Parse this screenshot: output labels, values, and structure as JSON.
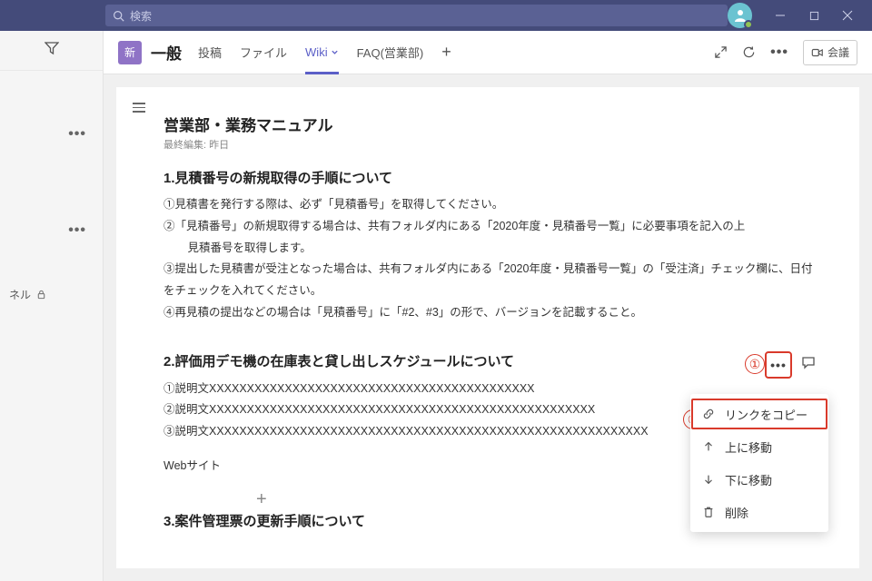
{
  "search": {
    "placeholder": "検索"
  },
  "window": {
    "avatar_initial": ""
  },
  "sidebar": {
    "channel_partial": "ネル",
    "locked": true
  },
  "channel": {
    "team_badge": "新",
    "name": "一般",
    "tabs": [
      {
        "label": "投稿",
        "active": false
      },
      {
        "label": "ファイル",
        "active": false
      },
      {
        "label": "Wiki",
        "active": true,
        "dropdown": true
      },
      {
        "label": "FAQ(営業部)",
        "active": false
      }
    ],
    "meet_label": "会議"
  },
  "doc": {
    "title": "営業部・業務マニュアル",
    "meta": "最終編集: 昨日",
    "sections": [
      {
        "title": "1.見積番号の新規取得の手順について",
        "lines": [
          "①見積書を発行する際は、必ず「見積番号」を取得してください。",
          "②「見積番号」の新規取得する場合は、共有フォルダ内にある「2020年度・見積番号一覧」に必要事項を記入の上",
          "　見積番号を取得します。",
          "③提出した見積書が受注となった場合は、共有フォルダ内にある「2020年度・見積番号一覧」の「受注済」チェック欄に、日付をチェックを入れてください。",
          "④再見積の提出などの場合は「見積番号」に「#2、#3」の形で、バージョンを記載すること。"
        ]
      },
      {
        "title": "2.評価用デモ機の在庫表と貸し出しスケジュールについて",
        "lines": [
          "①説明文XXXXXXXXXXXXXXXXXXXXXXXXXXXXXXXXXXXXXXXXXXX",
          "②説明文XXXXXXXXXXXXXXXXXXXXXXXXXXXXXXXXXXXXXXXXXXXXXXXXXXX",
          "③説明文XXXXXXXXXXXXXXXXXXXXXXXXXXXXXXXXXXXXXXXXXXXXXXXXXXXXXXXXXX"
        ],
        "footer": "Webサイト"
      },
      {
        "title": "3.案件管理票の更新手順について",
        "lines": []
      }
    ]
  },
  "callouts": {
    "one": "①",
    "two": "②"
  },
  "menu": {
    "items": [
      {
        "label": "リンクをコピー",
        "icon": "link"
      },
      {
        "label": "上に移動",
        "icon": "up"
      },
      {
        "label": "下に移動",
        "icon": "down"
      },
      {
        "label": "削除",
        "icon": "trash"
      }
    ]
  }
}
